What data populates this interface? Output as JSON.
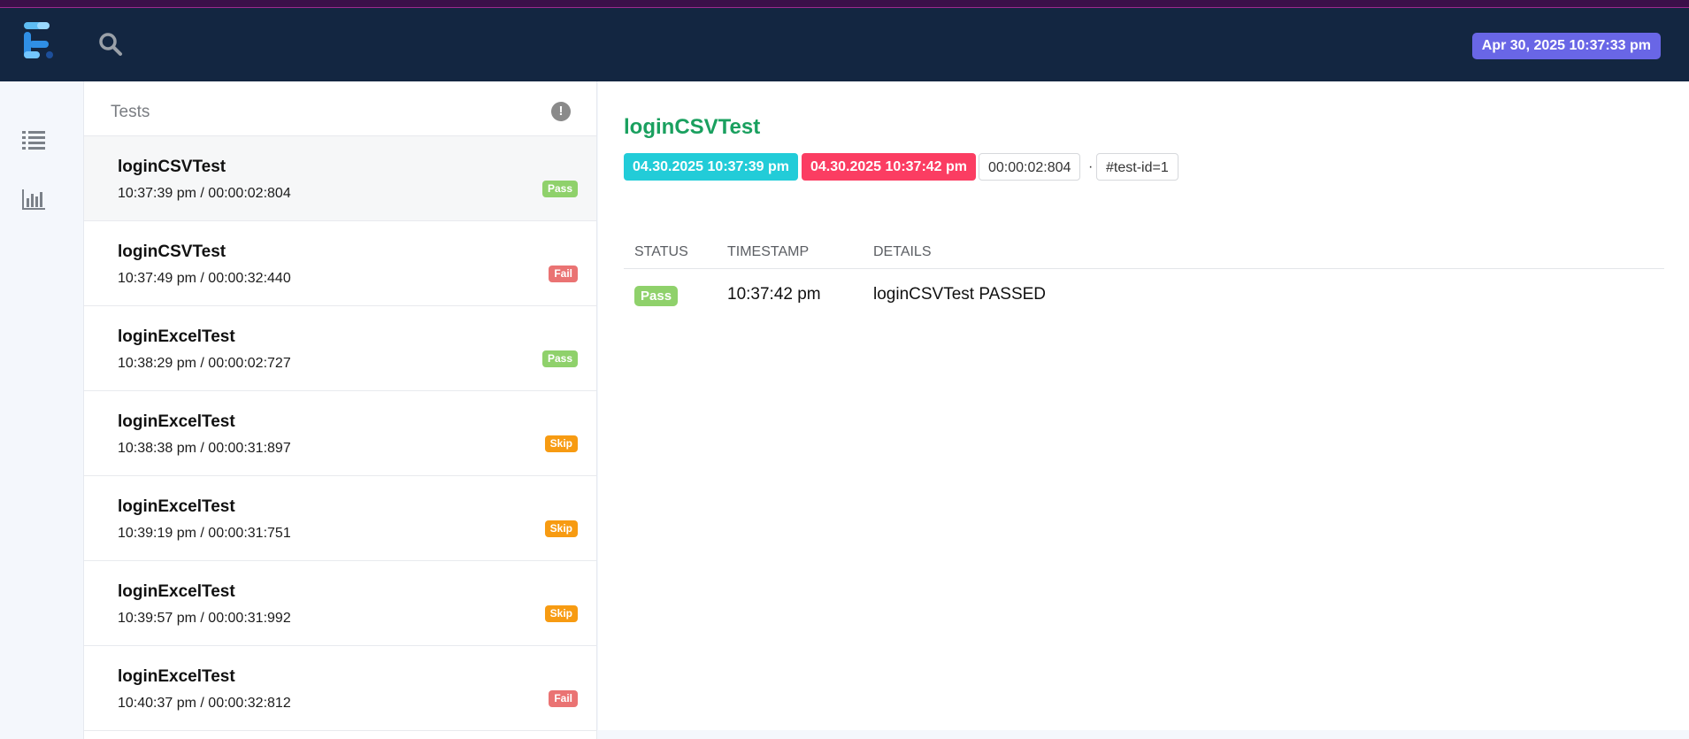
{
  "header": {
    "report_date": "Apr 30, 2025 10:37:33 pm",
    "logo_icon": "extent-logo-icon",
    "search_icon": "search-icon"
  },
  "sidebar": {
    "items": [
      {
        "icon": "list-icon",
        "label": ""
      },
      {
        "icon": "bar-chart-icon",
        "label": ""
      }
    ]
  },
  "tests_panel": {
    "title": "Tests",
    "alert_symbol": "!",
    "items": [
      {
        "name": "loginCSVTest",
        "meta": "10:37:39 pm / 00:00:02:804",
        "status": "Pass"
      },
      {
        "name": "loginCSVTest",
        "meta": "10:37:49 pm / 00:00:32:440",
        "status": "Fail"
      },
      {
        "name": "loginExcelTest",
        "meta": "10:38:29 pm / 00:00:02:727",
        "status": "Pass"
      },
      {
        "name": "loginExcelTest",
        "meta": "10:38:38 pm / 00:00:31:897",
        "status": "Skip"
      },
      {
        "name": "loginExcelTest",
        "meta": "10:39:19 pm / 00:00:31:751",
        "status": "Skip"
      },
      {
        "name": "loginExcelTest",
        "meta": "10:39:57 pm / 00:00:31:992",
        "status": "Skip"
      },
      {
        "name": "loginExcelTest",
        "meta": "10:40:37 pm / 00:00:32:812",
        "status": "Fail"
      }
    ]
  },
  "detail": {
    "title": "loginCSVTest",
    "start": "04.30.2025 10:37:39 pm",
    "end": "04.30.2025 10:37:42 pm",
    "duration": "00:00:02:804",
    "separator": "·",
    "test_id": "#test-id=1",
    "log_headers": {
      "status": "STATUS",
      "timestamp": "TIMESTAMP",
      "details": "DETAILS"
    },
    "log_rows": [
      {
        "status": "Pass",
        "timestamp": "10:37:42 pm",
        "details": "loginCSVTest PASSED"
      }
    ]
  },
  "colors": {
    "navbar": "#132641",
    "pass": "#8fd16b",
    "fail": "#ea7373",
    "skip": "#f79b12",
    "title_green": "#1aa05f",
    "date_badge": "#6966e6"
  }
}
